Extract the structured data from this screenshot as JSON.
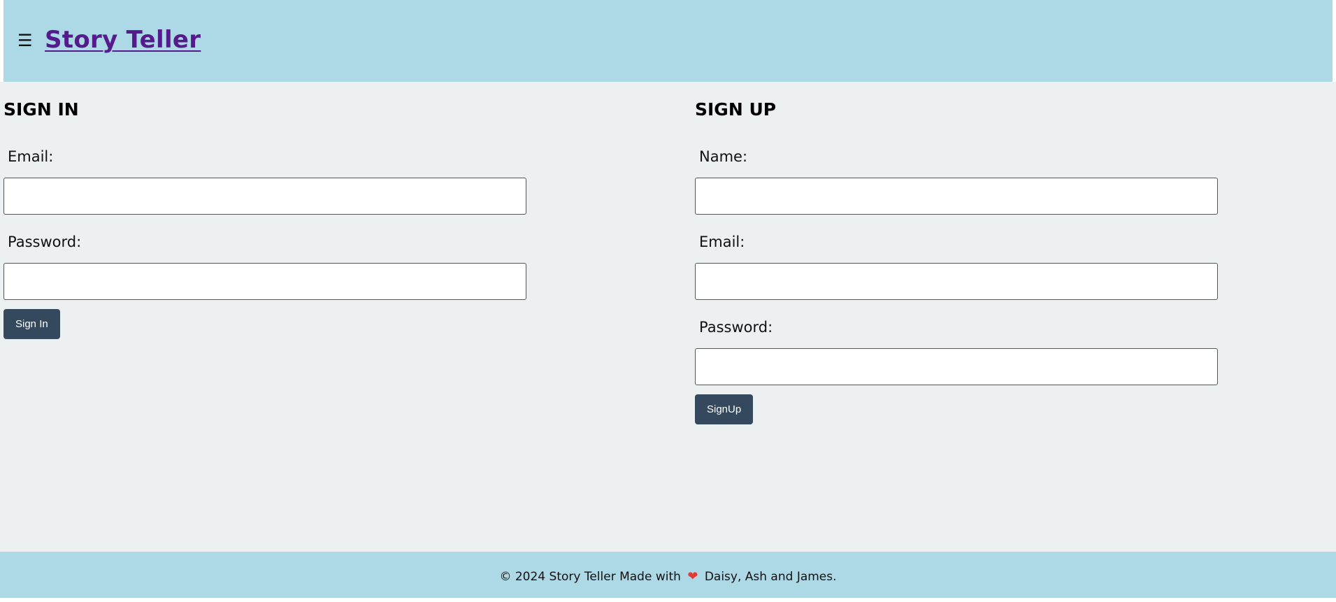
{
  "header": {
    "menu_icon": "☰",
    "brand": "Story Teller"
  },
  "signin": {
    "title": "SIGN IN",
    "email_label": "Email:",
    "email_value": "",
    "password_label": "Password:",
    "password_value": "",
    "button_label": "Sign In"
  },
  "signup": {
    "title": "SIGN UP",
    "name_label": "Name:",
    "name_value": "",
    "email_label": "Email:",
    "email_value": "",
    "password_label": "Password:",
    "password_value": "",
    "button_label": "SignUp"
  },
  "footer": {
    "text_before": "© 2024 Story Teller Made with",
    "heart": "❤",
    "text_after": "Daisy, Ash and James."
  },
  "colors": {
    "header_bg": "#add8e6",
    "main_bg": "#ecf0f1",
    "button_bg": "#34495e",
    "brand_link": "#551a8b",
    "heart": "#e53935"
  },
  "icons": {
    "menu": "hamburger-menu-icon",
    "heart": "heart-icon"
  }
}
